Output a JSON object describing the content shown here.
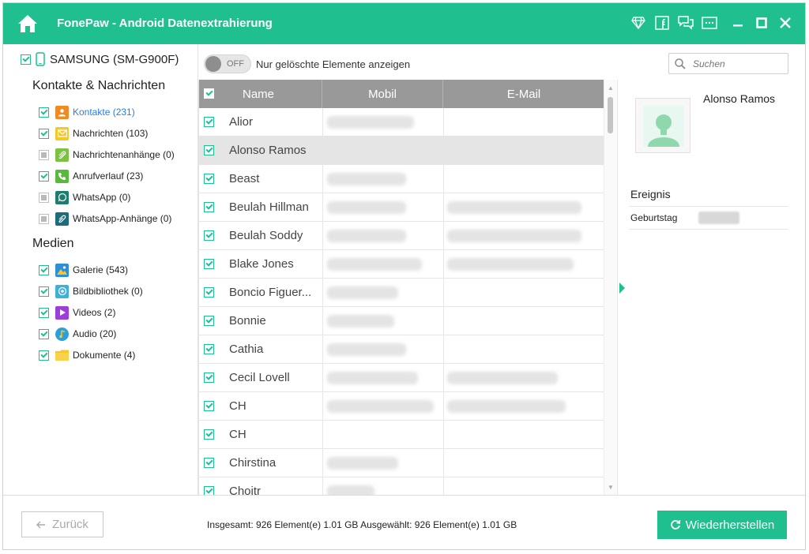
{
  "titlebar": {
    "title": "FonePaw - Android Datenextrahierung",
    "icons": [
      "home-icon",
      "diamond-icon",
      "facebook-icon",
      "chat-icon",
      "menu-icon",
      "minimize-icon",
      "maximize-icon",
      "close-icon"
    ]
  },
  "sidebar": {
    "device": "SAMSUNG (SM-G900F)",
    "category_contacts": "Kontakte & Nachrichten",
    "category_media": "Medien",
    "items": [
      {
        "label": "Kontakte (231)",
        "icon": "contacts-icon",
        "color": "#f08a24",
        "checked": "checked"
      },
      {
        "label": "Nachrichten (103)",
        "icon": "messages-icon",
        "color": "#f5c72b",
        "checked": "checked"
      },
      {
        "label": "Nachrichtenanhänge (0)",
        "icon": "attachment-icon",
        "color": "#7cc242",
        "checked": "partial"
      },
      {
        "label": "Anrufverlauf (23)",
        "icon": "phone-icon",
        "color": "#5ab83f",
        "checked": "checked"
      },
      {
        "label": "WhatsApp (0)",
        "icon": "whatsapp-icon",
        "color": "#1d7e6f",
        "checked": "partial"
      },
      {
        "label": "WhatsApp-Anhänge (0)",
        "icon": "whatsapp-attachment-icon",
        "color": "#1d6c7e",
        "checked": "partial"
      },
      {
        "label": "Galerie (543)",
        "icon": "gallery-icon",
        "color": "#2d8fd8",
        "checked": "checked"
      },
      {
        "label": "Bildbibliothek (0)",
        "icon": "picture-library-icon",
        "color": "#3fb0d8",
        "checked": "checked"
      },
      {
        "label": "Videos (2)",
        "icon": "video-icon",
        "color": "#9b3fd8",
        "checked": "checked"
      },
      {
        "label": "Audio (20)",
        "icon": "audio-icon",
        "color": "#2d9fd8",
        "checked": "checked"
      },
      {
        "label": "Dokumente (4)",
        "icon": "folder-icon",
        "color": "#f5c72b",
        "checked": "checked"
      }
    ]
  },
  "toolbar": {
    "toggle_state": "OFF",
    "toggle_label": "Nur gelöschte Elemente anzeigen",
    "search_placeholder": "Suchen"
  },
  "table": {
    "columns": [
      "Name",
      "Mobil",
      "E-Mail"
    ],
    "rows": [
      {
        "name": "Alior",
        "mobile_blurred": true,
        "email_blurred": false
      },
      {
        "name": "Alonso Ramos",
        "mobile_blurred": false,
        "email_blurred": false,
        "selected": true
      },
      {
        "name": "Beast",
        "mobile_blurred": true,
        "email_blurred": false
      },
      {
        "name": "Beulah Hillman",
        "mobile_blurred": true,
        "email_blurred": true
      },
      {
        "name": "Beulah Soddy",
        "mobile_blurred": true,
        "email_blurred": true
      },
      {
        "name": "Blake Jones",
        "mobile_blurred": true,
        "email_blurred": true
      },
      {
        "name": "Boncio Figuer...",
        "mobile_blurred": true,
        "email_blurred": false
      },
      {
        "name": "Bonnie",
        "mobile_blurred": true,
        "email_blurred": false
      },
      {
        "name": "Cathia",
        "mobile_blurred": true,
        "email_blurred": false
      },
      {
        "name": "Cecil Lovell",
        "mobile_blurred": true,
        "email_blurred": true
      },
      {
        "name": "CH",
        "mobile_blurred": true,
        "email_blurred": true
      },
      {
        "name": "CH",
        "mobile_blurred": false,
        "email_blurred": false
      },
      {
        "name": "Chirstina",
        "mobile_blurred": true,
        "email_blurred": false
      },
      {
        "name": "Choitr",
        "mobile_blurred": true,
        "email_blurred": false
      }
    ]
  },
  "detail": {
    "name": "Alonso Ramos",
    "section": "Ereignis",
    "field_label": "Geburtstag"
  },
  "footer": {
    "back_label": "Zurück",
    "stats": "Insgesamt: 926 Element(e) 1.01 GB    Ausgewählt: 926 Element(e) 1.01 GB",
    "restore_label": "Wiederherstellen"
  },
  "colors": {
    "accent": "#1fbf8f",
    "header_gray": "#999999"
  }
}
